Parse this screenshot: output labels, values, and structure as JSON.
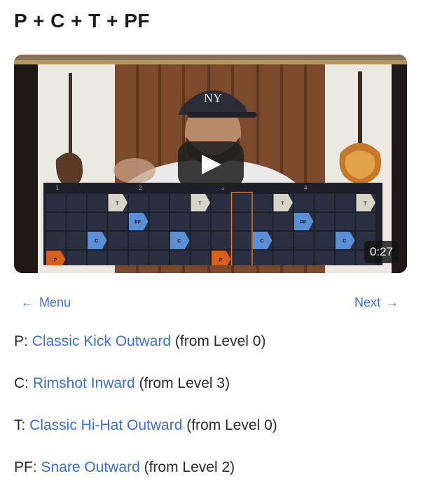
{
  "page": {
    "title": "P + C + T + PF"
  },
  "video": {
    "duration": "0:27",
    "grid": {
      "beat_labels": [
        "1",
        "2",
        "3",
        "4"
      ],
      "rows": [
        {
          "label": "T",
          "color": "#d9d4c8",
          "cols": [
            3,
            7,
            11,
            15
          ]
        },
        {
          "label": "PF",
          "color": "#5b8fd6",
          "cols": [
            4,
            12
          ]
        },
        {
          "label": "C",
          "color": "#5b8fd6",
          "cols": [
            2,
            6,
            10,
            14
          ]
        },
        {
          "label": "P",
          "color": "#d8601f",
          "cols": [
            0,
            8
          ]
        }
      ],
      "highlight_col": 9
    }
  },
  "nav": {
    "prev_label": "Menu",
    "next_label": "Next"
  },
  "lines": [
    {
      "prefix": "P: ",
      "link": "Classic Kick Outward",
      "suffix": " (from Level 0)"
    },
    {
      "prefix": "C: ",
      "link": "Rimshot Inward",
      "suffix": " (from Level 3)"
    },
    {
      "prefix": "T: ",
      "link": "Classic Hi-Hat Outward",
      "suffix": " (from Level 0)"
    },
    {
      "prefix": "PF: ",
      "link": "Snare Outward",
      "suffix": " (from Level 2)"
    }
  ]
}
